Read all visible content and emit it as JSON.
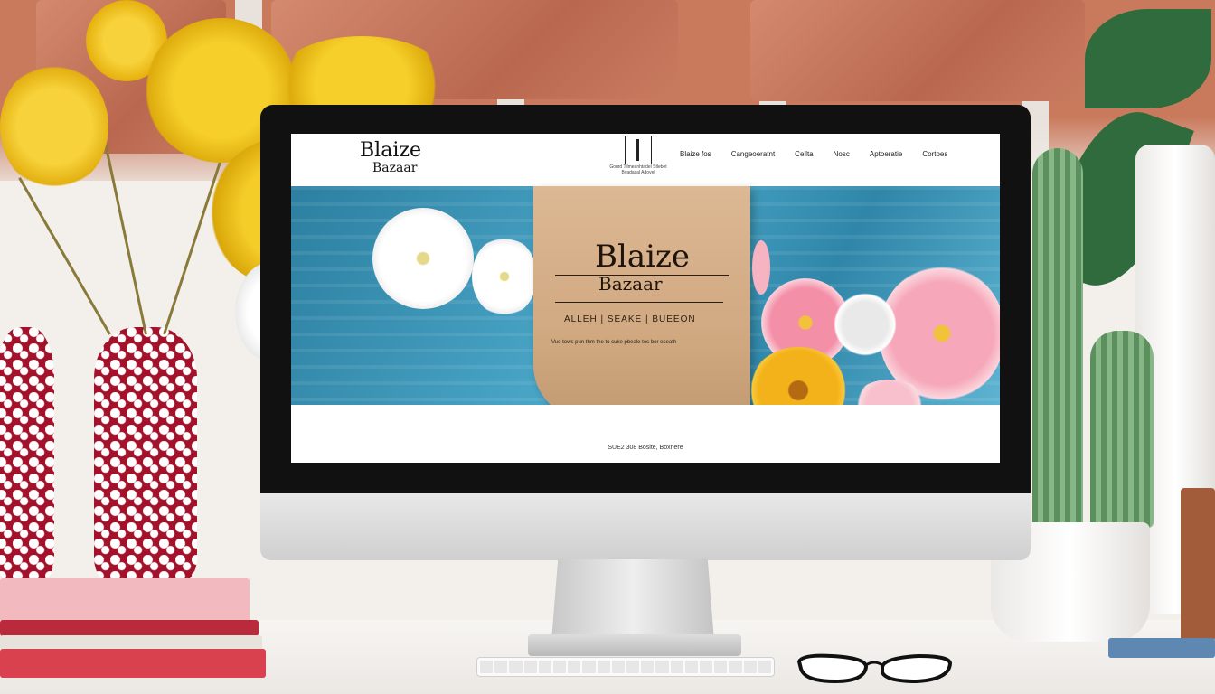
{
  "scene": {
    "device": "iMac",
    "colors": {
      "brick": "#c9795c",
      "vase_red": "#a3122a",
      "mimosa_yellow": "#f2c418",
      "desk": "#f7f5f2"
    }
  },
  "website": {
    "logo": {
      "main": "Blaize",
      "sub": "Bazaar"
    },
    "emblem_tagline": [
      "Gourd Tilmeanhtadel Stlebet",
      "Bvadasal Adovel"
    ],
    "nav": [
      "Blaize fos",
      "Cangeoeratnt",
      "Ceilta",
      "Nosc",
      "Aptoeratie",
      "Cortoes"
    ],
    "hero": {
      "title": "Blaize",
      "subtitle": "Bazaar",
      "links": "ALLEH | SEAKE | BUEEON",
      "description": "Vuo tows pun thm the to cuke pbeale tes bor eseath"
    },
    "footer_text": "SUE2 308 Bosite, Boxrlere",
    "colors": {
      "sea_blue": "#3a95b8",
      "board_wood": "#d6b08a",
      "text": "#1e140c"
    }
  }
}
